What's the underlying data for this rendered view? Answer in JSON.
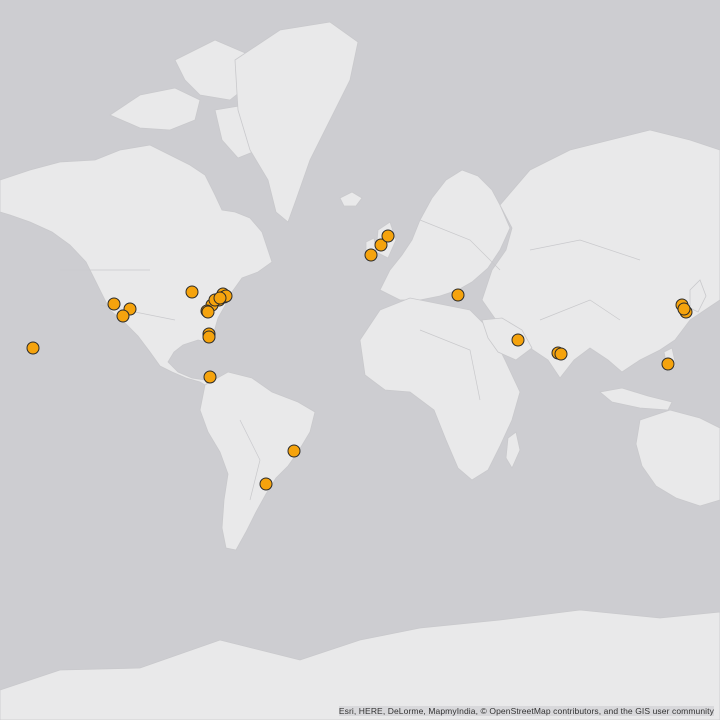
{
  "map": {
    "attribution": "Esri, HERE, DeLorme, MapmyIndia, © OpenStreetMap contributors, and the GIS user community",
    "colors": {
      "ocean": "#cdcdd1",
      "land": "#e9e9ea",
      "border": "#c9c9cc",
      "marker_fill": "#f5a30d",
      "marker_stroke": "#2b2b2b"
    },
    "marker_count": 30
  }
}
